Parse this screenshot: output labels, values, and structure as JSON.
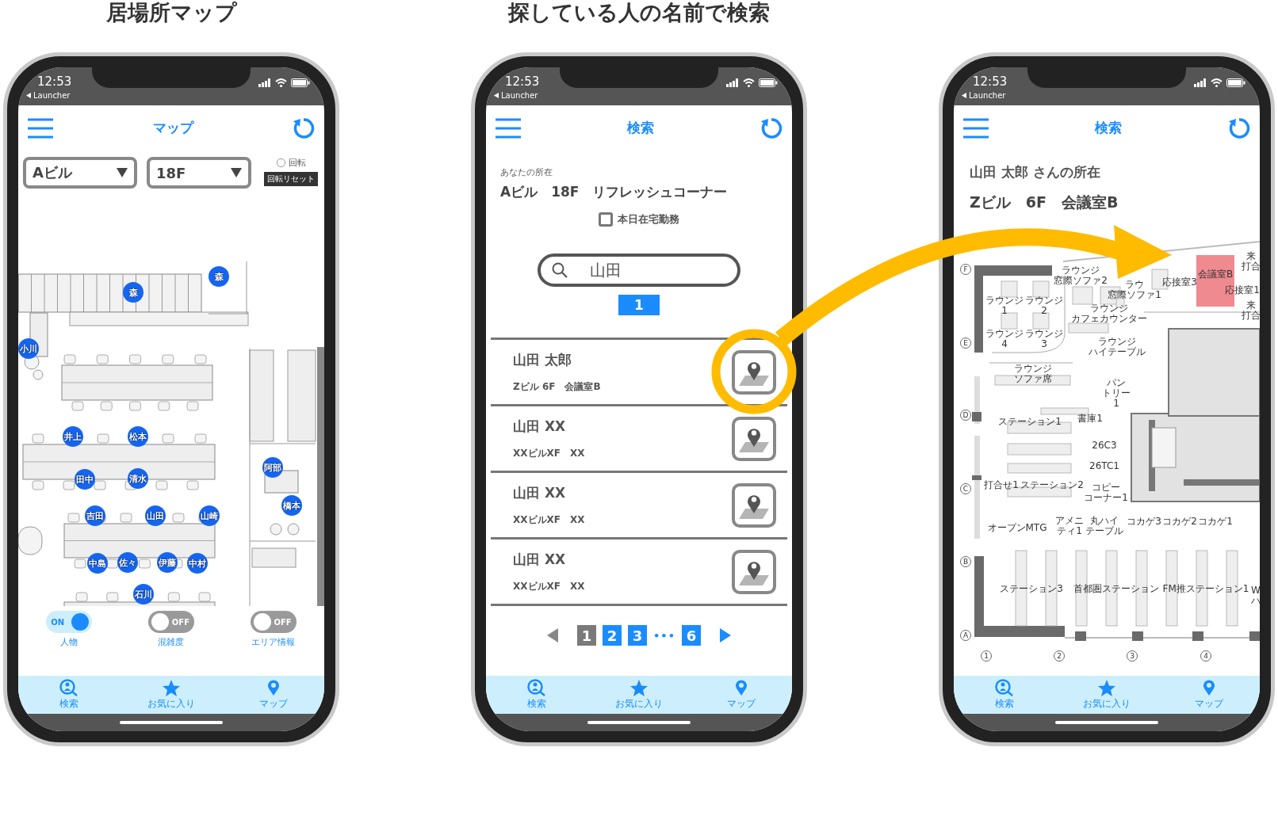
{
  "captions": [
    "居場所マップ",
    "探している人の名前で検索"
  ],
  "map_screen": {
    "status_bar": {
      "time": "12:53",
      "back_label": "Launcher"
    },
    "header": {
      "title": "マップ"
    },
    "building_select": {
      "value": "Aビル"
    },
    "floor_select": {
      "value": "18F"
    },
    "rotate_checkbox": {
      "label": "回転",
      "checked": false
    },
    "rotate_reset_button": "回転リセット",
    "person_markers": [
      "森",
      "森",
      "小川",
      "井上",
      "松本",
      "田中",
      "清水",
      "阿部",
      "橋本",
      "吉田",
      "山田",
      "山崎",
      "中島",
      "佐々",
      "伊藤",
      "中村",
      "石川"
    ],
    "toggles": [
      {
        "label": "人物",
        "text": "ON",
        "on": true
      },
      {
        "label": "混雑度",
        "text": "OFF",
        "on": false
      },
      {
        "label": "エリア情報",
        "text": "OFF",
        "on": false
      }
    ],
    "tab_bar": [
      {
        "label": "検索",
        "kind": "search"
      },
      {
        "label": "お気に入り",
        "kind": "star"
      },
      {
        "label": "マップ",
        "kind": "pin"
      }
    ]
  },
  "search_screen": {
    "status_bar": {
      "time": "12:53",
      "back_label": "Launcher"
    },
    "header": {
      "title": "検索"
    },
    "your_location_label": "あなたの所在",
    "your_location": "Aビル　18F　リフレッシュコーナー",
    "work_from_home": {
      "label": "本日在宅勤務",
      "checked": false
    },
    "search_field": {
      "value": "山田"
    },
    "result_count": "1",
    "results": [
      {
        "name": "山田 太郎",
        "location": "Zビル 6F　会議室B"
      },
      {
        "name": "山田 XX",
        "location": "XXビルXF　XX"
      },
      {
        "name": "山田 XX",
        "location": "XXビルXF　XX"
      },
      {
        "name": "山田 XX",
        "location": "XXビルXF　XX"
      }
    ],
    "pagination": {
      "prev_disabled": true,
      "next_disabled": false,
      "items": [
        {
          "kind": "page",
          "label": "1",
          "selected": true
        },
        {
          "kind": "page",
          "label": "2",
          "selected": false
        },
        {
          "kind": "page",
          "label": "3",
          "selected": false
        },
        {
          "kind": "ellipsis",
          "label": "•••"
        },
        {
          "kind": "page",
          "label": "6",
          "selected": false
        }
      ]
    },
    "tab_bar": [
      {
        "label": "検索",
        "kind": "search"
      },
      {
        "label": "お気に入り",
        "kind": "star"
      },
      {
        "label": "マップ",
        "kind": "pin"
      }
    ]
  },
  "location_screen": {
    "status_bar": {
      "time": "12:53",
      "back_label": "Launcher"
    },
    "header": {
      "title": "検索"
    },
    "heading": "山田 太郎 さんの所在",
    "location": "Zビル　6F　会議室B",
    "grid_rows": [
      "F",
      "E",
      "D",
      "C",
      "B",
      "A"
    ],
    "grid_columns": [
      "1",
      "2",
      "3",
      "4"
    ],
    "room_labels": [
      [
        "ラウンジ",
        "窓際ソファ2"
      ],
      [
        "ラウ",
        "窓際ソファ1"
      ],
      [
        "応接室3"
      ],
      [
        "会議室B"
      ],
      [
        "来",
        "打合"
      ],
      [
        "応接室1"
      ],
      [
        "ラウンジ",
        "1"
      ],
      [
        "ラウンジ",
        "2"
      ],
      [
        "ラウンジ",
        "カフェカウンター"
      ],
      [
        "来",
        "打合"
      ],
      [
        "ラウンジ",
        "4"
      ],
      [
        "ラウンジ",
        "3"
      ],
      [
        "ラウンジ",
        "ハイテーブル"
      ],
      [
        "ラウンジ",
        "ソファ席"
      ],
      [
        "パン",
        "トリー",
        "1"
      ],
      [
        "ステーション1"
      ],
      [
        "書庫1"
      ],
      [
        "26C3"
      ],
      [
        "26TC1"
      ],
      [
        "打合せ1"
      ],
      [
        "ステーション2"
      ],
      [
        "コピー",
        "コーナー1"
      ],
      [
        "オープンMTG"
      ],
      [
        "アメニ",
        "ティ1"
      ],
      [
        "丸ハイ",
        "テーブル"
      ],
      [
        "コカゲ3"
      ],
      [
        "コカゲ2"
      ],
      [
        "コカゲ1"
      ],
      [
        "ステーション3"
      ],
      [
        "首都圏ステーション"
      ],
      [
        "FM推ステーション1"
      ],
      [
        "W",
        "ハ"
      ]
    ],
    "tab_bar": [
      {
        "label": "検索",
        "kind": "search"
      },
      {
        "label": "お気に入り",
        "kind": "star"
      },
      {
        "label": "マップ",
        "kind": "pin"
      }
    ]
  }
}
